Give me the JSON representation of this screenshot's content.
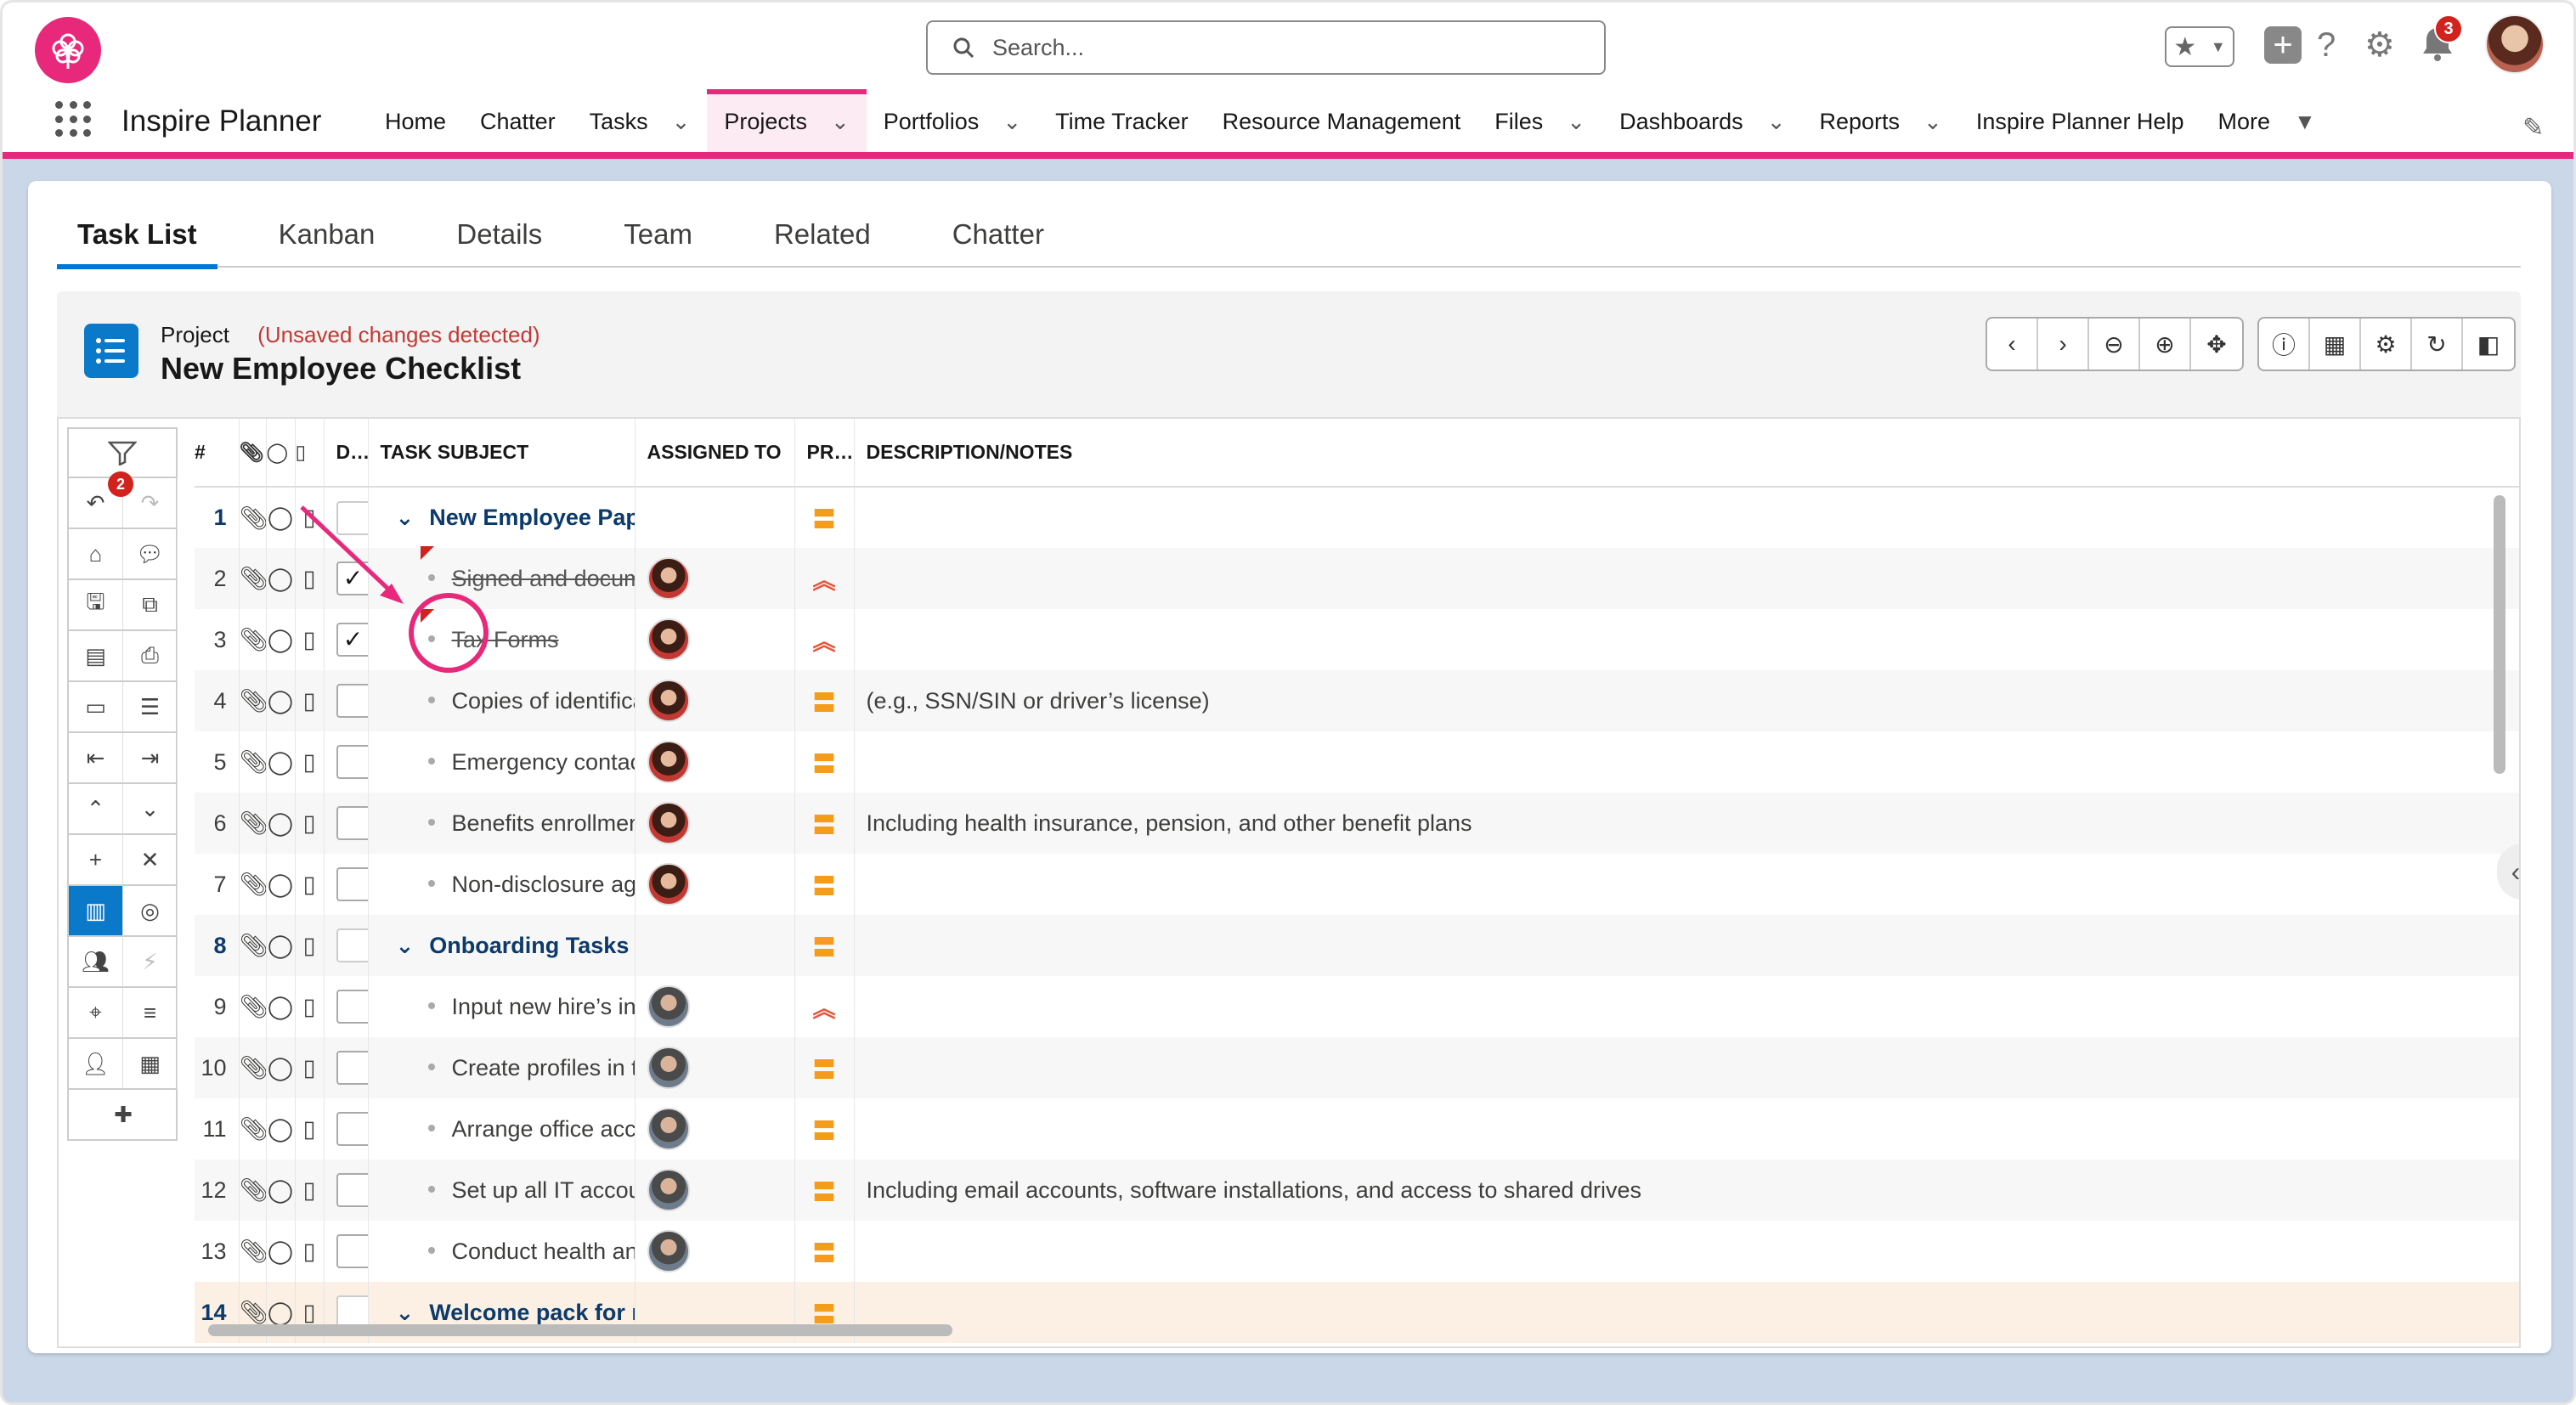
{
  "header": {
    "search_placeholder": "Search...",
    "app_name": "Inspire Planner",
    "notification_count": "3",
    "nav": [
      {
        "label": "Home",
        "dropdown": false
      },
      {
        "label": "Chatter",
        "dropdown": false
      },
      {
        "label": "Tasks",
        "dropdown": true
      },
      {
        "label": "Projects",
        "dropdown": true,
        "active": true
      },
      {
        "label": "Portfolios",
        "dropdown": true
      },
      {
        "label": "Time Tracker",
        "dropdown": false
      },
      {
        "label": "Resource Management",
        "dropdown": false
      },
      {
        "label": "Files",
        "dropdown": true
      },
      {
        "label": "Dashboards",
        "dropdown": true
      },
      {
        "label": "Reports",
        "dropdown": true
      },
      {
        "label": "Inspire Planner Help",
        "dropdown": false
      },
      {
        "label": "More",
        "dropdown": true
      }
    ]
  },
  "tabs": [
    "Task List",
    "Kanban",
    "Details",
    "Team",
    "Related",
    "Chatter"
  ],
  "project": {
    "label": "Project",
    "unsaved": "(Unsaved changes detected)",
    "name": "New Employee Checklist"
  },
  "left_toolbar": {
    "filter_badge": "2"
  },
  "columns": {
    "num": "#",
    "done": "DONE",
    "subject": "TASK SUBJECT",
    "assigned": "ASSIGNED TO",
    "priority": "PRIORI...",
    "notes": "DESCRIPTION/NOTES"
  },
  "rows": [
    {
      "n": "1",
      "group": true,
      "done": false,
      "subject": "New Employee Paperwork",
      "assignee": "",
      "priority": "medium",
      "notes": ""
    },
    {
      "n": "2",
      "group": false,
      "done": true,
      "subject": "Signed and documented offer letter, cor",
      "assignee": "f",
      "priority": "high",
      "notes": ""
    },
    {
      "n": "3",
      "group": false,
      "done": true,
      "subject": "Tax Forms",
      "assignee": "f",
      "priority": "high",
      "notes": ""
    },
    {
      "n": "4",
      "group": false,
      "done": false,
      "subject": "Copies of identification documents",
      "assignee": "f",
      "priority": "medium",
      "notes": "(e.g., SSN/SIN or driver’s license)"
    },
    {
      "n": "5",
      "group": false,
      "done": false,
      "subject": "Emergency contact information",
      "assignee": "f",
      "priority": "medium",
      "notes": ""
    },
    {
      "n": "6",
      "group": false,
      "done": false,
      "subject": "Benefits enrollment forms",
      "assignee": "f",
      "priority": "medium",
      "notes": "Including health insurance, pension, and other benefit plans"
    },
    {
      "n": "7",
      "group": false,
      "done": false,
      "subject": "Non-disclosure agreement (NDA) or cor",
      "assignee": "f",
      "priority": "medium",
      "notes": ""
    },
    {
      "n": "8",
      "group": true,
      "done": false,
      "subject": "Onboarding Tasks",
      "assignee": "",
      "priority": "medium",
      "notes": ""
    },
    {
      "n": "9",
      "group": false,
      "done": false,
      "subject": "Input new hire’s information into the pay",
      "assignee": "m",
      "priority": "high",
      "notes": ""
    },
    {
      "n": "10",
      "group": false,
      "done": false,
      "subject": "Create profiles in the necessary internal",
      "assignee": "m",
      "priority": "medium",
      "notes": ""
    },
    {
      "n": "11",
      "group": false,
      "done": false,
      "subject": "Arrange office access cards or passwor",
      "assignee": "m",
      "priority": "medium",
      "notes": ""
    },
    {
      "n": "12",
      "group": false,
      "done": false,
      "subject": "Set up all IT accounts",
      "assignee": "m",
      "priority": "medium",
      "notes": "Including email accounts, software installations, and access to shared drives"
    },
    {
      "n": "13",
      "group": false,
      "done": false,
      "subject": "Conduct health and safety training",
      "assignee": "m",
      "priority": "medium",
      "notes": ""
    },
    {
      "n": "14",
      "group": true,
      "done": false,
      "subject": "Welcome pack for new employee",
      "assignee": "",
      "priority": "medium",
      "notes": ""
    }
  ],
  "colors": {
    "brand": "#e8287a",
    "accent": "#0b79c9",
    "unsaved": "#c23934",
    "priority_medium": "#f59c1a",
    "priority_high": "#e8553a"
  }
}
